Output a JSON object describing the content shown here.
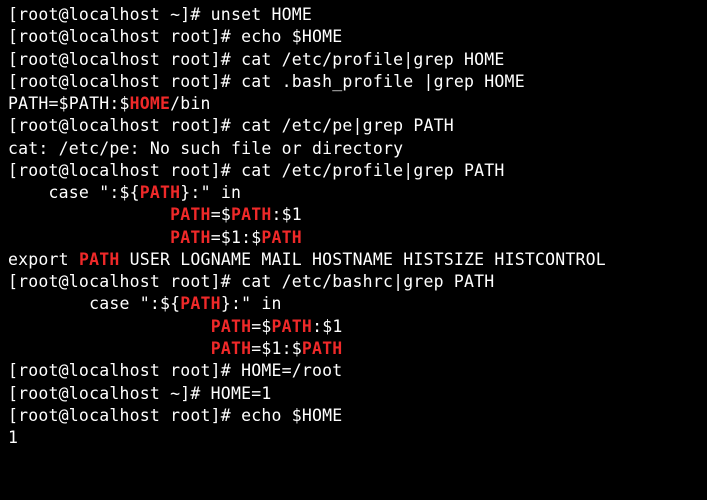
{
  "lines": [
    {
      "segments": [
        {
          "t": "[root@localhost ~]# unset HOME",
          "c": "w"
        }
      ]
    },
    {
      "segments": [
        {
          "t": "[root@localhost root]# echo $HOME",
          "c": "w"
        }
      ]
    },
    {
      "segments": [
        {
          "t": "",
          "c": "w"
        }
      ]
    },
    {
      "segments": [
        {
          "t": "[root@localhost root]# cat /etc/profile|grep HOME",
          "c": "w"
        }
      ]
    },
    {
      "segments": [
        {
          "t": "[root@localhost root]# cat .bash_profile |grep HOME",
          "c": "w"
        }
      ]
    },
    {
      "segments": [
        {
          "t": "PATH=$PATH:$",
          "c": "w"
        },
        {
          "t": "HOME",
          "c": "r"
        },
        {
          "t": "/bin",
          "c": "w"
        }
      ]
    },
    {
      "segments": [
        {
          "t": "[root@localhost root]# cat /etc/pe|grep PATH",
          "c": "w"
        }
      ]
    },
    {
      "segments": [
        {
          "t": "cat: /etc/pe: No such file or directory",
          "c": "w"
        }
      ]
    },
    {
      "segments": [
        {
          "t": "[root@localhost root]# cat /etc/profile|grep PATH",
          "c": "w"
        }
      ]
    },
    {
      "segments": [
        {
          "t": "    case \":${",
          "c": "w"
        },
        {
          "t": "PATH",
          "c": "r"
        },
        {
          "t": "}:\" in",
          "c": "w"
        }
      ]
    },
    {
      "segments": [
        {
          "t": "                ",
          "c": "w"
        },
        {
          "t": "PATH",
          "c": "r"
        },
        {
          "t": "=$",
          "c": "w"
        },
        {
          "t": "PATH",
          "c": "r"
        },
        {
          "t": ":$1",
          "c": "w"
        }
      ]
    },
    {
      "segments": [
        {
          "t": "                ",
          "c": "w"
        },
        {
          "t": "PATH",
          "c": "r"
        },
        {
          "t": "=$1:$",
          "c": "w"
        },
        {
          "t": "PATH",
          "c": "r"
        }
      ]
    },
    {
      "segments": [
        {
          "t": "export ",
          "c": "w"
        },
        {
          "t": "PATH",
          "c": "r"
        },
        {
          "t": " USER LOGNAME MAIL HOSTNAME HISTSIZE HISTCONTROL",
          "c": "w"
        }
      ]
    },
    {
      "segments": [
        {
          "t": "[root@localhost root]# cat /etc/bashrc|grep PATH",
          "c": "w"
        }
      ]
    },
    {
      "segments": [
        {
          "t": "        case \":${",
          "c": "w"
        },
        {
          "t": "PATH",
          "c": "r"
        },
        {
          "t": "}:\" in",
          "c": "w"
        }
      ]
    },
    {
      "segments": [
        {
          "t": "                    ",
          "c": "w"
        },
        {
          "t": "PATH",
          "c": "r"
        },
        {
          "t": "=$",
          "c": "w"
        },
        {
          "t": "PATH",
          "c": "r"
        },
        {
          "t": ":$1",
          "c": "w"
        }
      ]
    },
    {
      "segments": [
        {
          "t": "                    ",
          "c": "w"
        },
        {
          "t": "PATH",
          "c": "r"
        },
        {
          "t": "=$1:$",
          "c": "w"
        },
        {
          "t": "PATH",
          "c": "r"
        }
      ]
    },
    {
      "segments": [
        {
          "t": "[root@localhost root]# HOME=/root",
          "c": "w"
        }
      ]
    },
    {
      "segments": [
        {
          "t": "[root@localhost ~]# HOME=1",
          "c": "w"
        }
      ]
    },
    {
      "segments": [
        {
          "t": "[root@localhost root]# echo $HOME",
          "c": "w"
        }
      ]
    },
    {
      "segments": [
        {
          "t": "1",
          "c": "w"
        }
      ]
    }
  ]
}
